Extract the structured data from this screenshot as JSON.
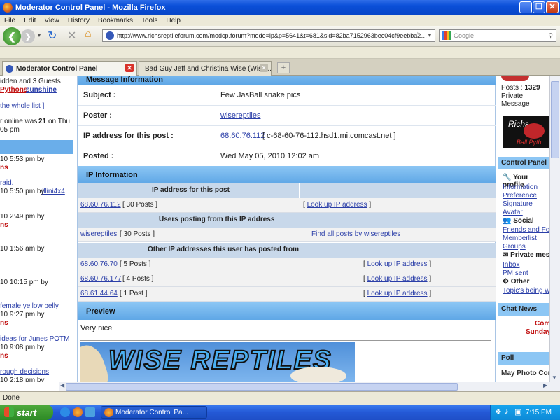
{
  "window": {
    "title": "Moderator Control Panel - Mozilla Firefox"
  },
  "menu": [
    "File",
    "Edit",
    "View",
    "History",
    "Bookmarks",
    "Tools",
    "Help"
  ],
  "nav": {
    "url": "http://www.richsreptileforum.com/modcp.forum?mode=ip&p=5641&t=681&sid=82ba7152963bec04cf9eebba2…",
    "search_placeholder": "Google"
  },
  "tabs": [
    {
      "label": "Moderator Control Panel",
      "active": true
    },
    {
      "label": "Bad Guy Jeff and Christina Wise (Wise ...",
      "active": false
    }
  ],
  "left": {
    "lines": [
      "idden and 3 Guests",
      "Pythons",
      "sunshine",
      "the whole list ]",
      "r online was",
      "21",
      "on Thu",
      "05 pm",
      "10 5:53 pm by",
      "ns",
      "raid.",
      "10 5:50 pm by",
      "illini4x4",
      "10 2:49 pm by",
      "ns",
      "10 1:56 am by",
      "10 10:15 pm by",
      "female yellow belly",
      "10 9:27 pm by",
      "ns",
      "ideas for Junes POTM",
      "10 9:08 pm by",
      "ns",
      "rough decisions",
      "10 2:18 pm by"
    ]
  },
  "message_info": {
    "header": "Message Information",
    "subject_label": "Subject :",
    "subject": "Few JasBall snake pics",
    "poster_label": "Poster :",
    "poster": "wisereptiles",
    "ip_label": "IP address for this post :",
    "ip": "68.60.76.112",
    "host": "[ c-68-60-76-112.hsd1.mi.comcast.net ]",
    "posted_label": "Posted :",
    "posted": "Wed May 05, 2010 12:02 am"
  },
  "ip_info": {
    "header": "IP Information",
    "ip_for_post_header": "IP address for this post",
    "post_ip": "68.60.76.112",
    "post_ip_count": "[ 30 Posts ]",
    "lookup_label": "Look up IP address",
    "users_header": "Users posting from this IP address",
    "user": "wisereptiles",
    "user_count": "[ 30 Posts ]",
    "find_all": "Find all posts by wisereptiles",
    "other_header": "Other IP addresses this user has posted from",
    "other_ips": [
      {
        "ip": "68.60.76.70",
        "count": "[ 5 Posts ]"
      },
      {
        "ip": "68.60.76.177",
        "count": "[ 4 Posts ]"
      },
      {
        "ip": "68.61.44.64",
        "count": "[ 1 Post ]"
      }
    ]
  },
  "preview": {
    "header": "Preview",
    "text": "Very nice",
    "banner_text": "WISE REPTILES"
  },
  "right": {
    "posts_label": "Posts :",
    "posts": "1329",
    "private_msg": "Private Message",
    "logo_text": "Richs",
    "logo_sub": "Ball Pyth",
    "control_panel": "Control Panel",
    "your_profile": "Your profile",
    "profile_links": [
      "Information",
      "Preference",
      "Signature",
      "Avatar"
    ],
    "social": "Social",
    "social_links": [
      "Friends and Foe",
      "Memberlist",
      "Groups"
    ],
    "private_mes": "Private mes",
    "pm_links": [
      "Inbox",
      "PM sent"
    ],
    "other": "Other",
    "other_links": [
      "Topic's being wa"
    ],
    "chat_news": "Chat News",
    "chat_lines": [
      "Com",
      "Sunday"
    ],
    "poll": "Poll",
    "poll_text": "May Photo Conte"
  },
  "status": "Done",
  "taskbar": {
    "start": "start",
    "task": "Moderator Control Pa...",
    "clock": "7:15 PM"
  }
}
